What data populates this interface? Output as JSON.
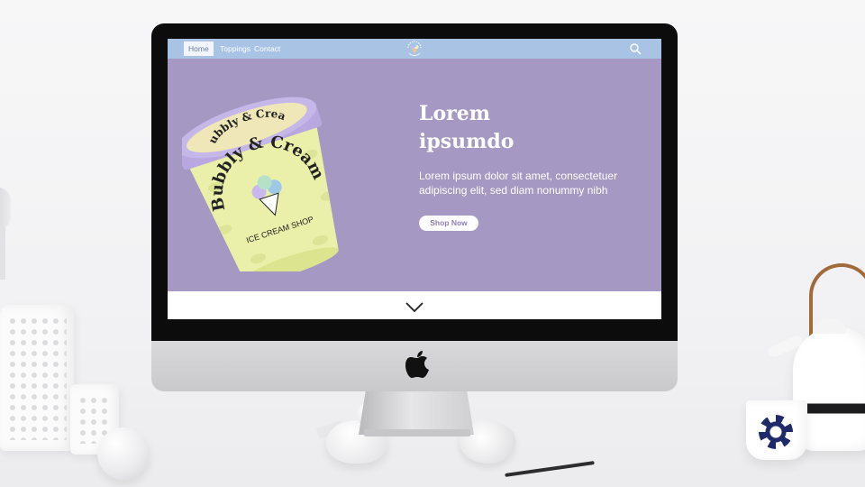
{
  "navbar": {
    "items": [
      {
        "label": "Home",
        "active": true
      },
      {
        "label": "Toppings",
        "active": false
      },
      {
        "label": "Contact",
        "active": false
      }
    ],
    "logo_icon": "ice-cream-logo-icon",
    "search_icon": "search-icon"
  },
  "hero": {
    "title_line1": "Lorem",
    "title_line2": "ipsumdo",
    "text_line1": "Lorem ipsum dolor sit amet, consectetuer",
    "text_line2": "adipiscing elit, sed diam nonummy nibh",
    "button_label": "Shop Now"
  },
  "product": {
    "brand": "Bubbly & Cream",
    "subtitle": "ICE CREAM SHOP"
  },
  "scroll": {
    "icon": "chevron-down-icon"
  },
  "colors": {
    "hero_background": "#a598c3",
    "navbar_background": "#a8c3e4",
    "tub_body": "#eaf0a9",
    "tub_lid": "#b8a8df",
    "button_text": "#8e80b5"
  }
}
